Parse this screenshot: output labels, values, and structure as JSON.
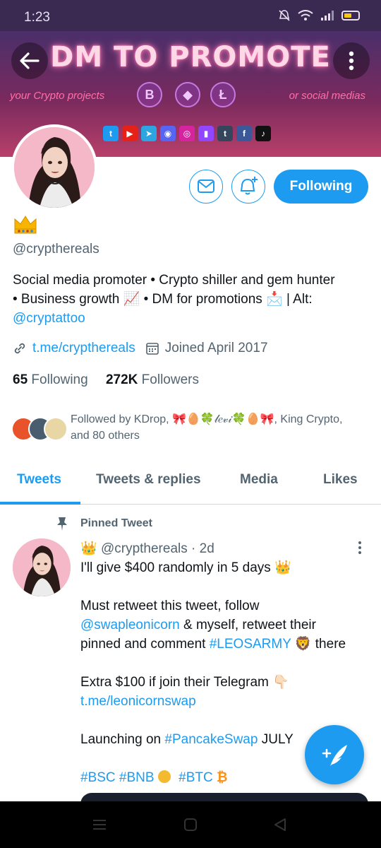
{
  "status_bar": {
    "time": "1:23"
  },
  "banner": {
    "title": "DM TO PROMOTE",
    "left_text": "your Crypto projects",
    "right_text": "or social medias",
    "coins": [
      "B",
      "◆",
      "Ł"
    ],
    "socials": [
      {
        "icon": "twitter-icon",
        "color": "#1d9bf0",
        "glyph": "t"
      },
      {
        "icon": "youtube-icon",
        "color": "#e62117",
        "glyph": "▶"
      },
      {
        "icon": "telegram-icon",
        "color": "#2ca5e0",
        "glyph": "➤"
      },
      {
        "icon": "discord-icon",
        "color": "#5865f2",
        "glyph": "◉"
      },
      {
        "icon": "instagram-icon",
        "color": "#d6249f",
        "glyph": "◎"
      },
      {
        "icon": "twitch-icon",
        "color": "#9146ff",
        "glyph": "▮"
      },
      {
        "icon": "tumblr-icon",
        "color": "#35465c",
        "glyph": "t"
      },
      {
        "icon": "facebook-icon",
        "color": "#3b5998",
        "glyph": "f"
      },
      {
        "icon": "tiktok-icon",
        "color": "#111111",
        "glyph": "♪"
      }
    ]
  },
  "profile": {
    "handle": "@crypthereals",
    "follow_label": "Following",
    "bio_line1": "Social media promoter • Crypto shiller and gem hunter",
    "bio_line2_a": "• Business growth ",
    "bio_line2_b": " • DM for promotions ",
    "bio_line2_c": " | Alt:",
    "bio_alt": "@cryptattoo",
    "website": "t.me/crypthereals",
    "joined": "Joined April 2017",
    "following_count": "65",
    "following_label": "Following",
    "followers_count": "272K",
    "followers_label": "Followers",
    "followed_by_line1": "Followed by KDrop, 🎀🥚🍀𝓁𝑒𝓋𝒾🍀🥚🎀, King Crypto,",
    "followed_by_line2": "and 80 others"
  },
  "tabs": [
    {
      "label": "Tweets",
      "active": true
    },
    {
      "label": "Tweets & replies",
      "active": false
    },
    {
      "label": "Media",
      "active": false
    },
    {
      "label": "Likes",
      "active": false
    }
  ],
  "tweet": {
    "pinned_label": "Pinned Tweet",
    "handle": "@crypthereals",
    "time": "· 2d",
    "line1": "I'll give $400 randomly in 5 days",
    "line2": "Must retweet this tweet, follow",
    "mention": "@swapleonicorn",
    "line3_tail": " & myself, retweet their",
    "line4_a": "pinned and comment ",
    "hashtag_leos": "#LEOSARMY",
    "line4_b": " there",
    "line5": "Extra $100 if join their Telegram",
    "tg_link": "t.me/leonicornswap",
    "line6_a": "Launching on ",
    "hashtag_pancake": "#PancakeSwap",
    "line6_b": " JULY",
    "tag_bsc": "#BSC",
    "tag_bnb": "#BNB",
    "tag_btc": "#BTC"
  },
  "colors": {
    "accent": "#1d9bf0",
    "text": "#0f1419",
    "muted": "#536471"
  }
}
